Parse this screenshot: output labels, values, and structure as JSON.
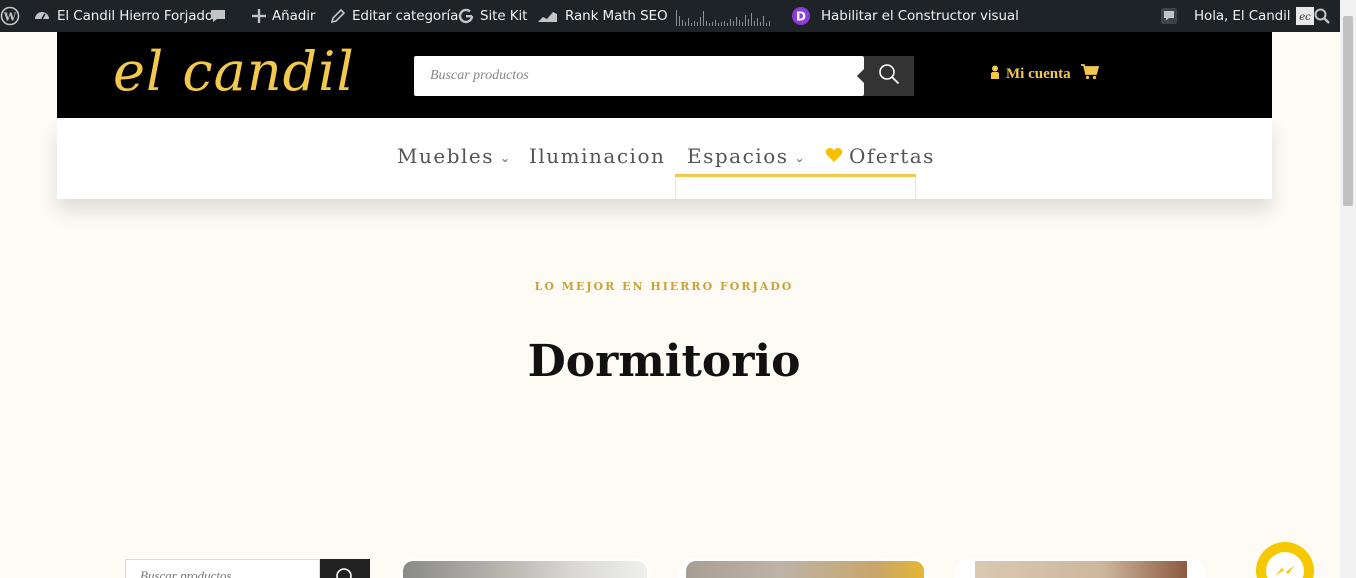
{
  "admin_bar": {
    "site_name": "El Candil Hierro Forjado",
    "add_new": "Añadir",
    "edit_category": "Editar categoría",
    "site_kit": "Site Kit",
    "rank_math": "Rank Math SEO",
    "visual_builder": "Habilitar el Constructor visual",
    "greeting": "Hola, El Candil"
  },
  "header": {
    "logo_text": "el candil",
    "search_placeholder": "Buscar productos",
    "account_label": "Mi cuenta"
  },
  "nav": {
    "items": [
      {
        "label": "Muebles",
        "has_dropdown": true
      },
      {
        "label": "Iluminacion",
        "has_dropdown": false
      },
      {
        "label": "Espacios",
        "has_dropdown": true
      },
      {
        "label": "Ofertas",
        "has_dropdown": false
      }
    ]
  },
  "hero": {
    "eyebrow": "LO MEJOR EN HIERRO FORJADO",
    "title": "Dormitorio"
  },
  "sidebar": {
    "search_placeholder": "Buscar productos"
  },
  "colors": {
    "accent": "#f2c94c",
    "admin_bar": "#1d2327",
    "page_bg": "#fdfbf3",
    "header_bg": "#000000"
  },
  "icons": [
    "wordpress-icon",
    "dashboard-icon",
    "comment-icon",
    "plus-icon",
    "pencil-icon",
    "google-icon",
    "rank-math-icon",
    "divi-icon",
    "search-icon",
    "user-icon",
    "cart-icon",
    "heart-icon",
    "messenger-icon"
  ]
}
